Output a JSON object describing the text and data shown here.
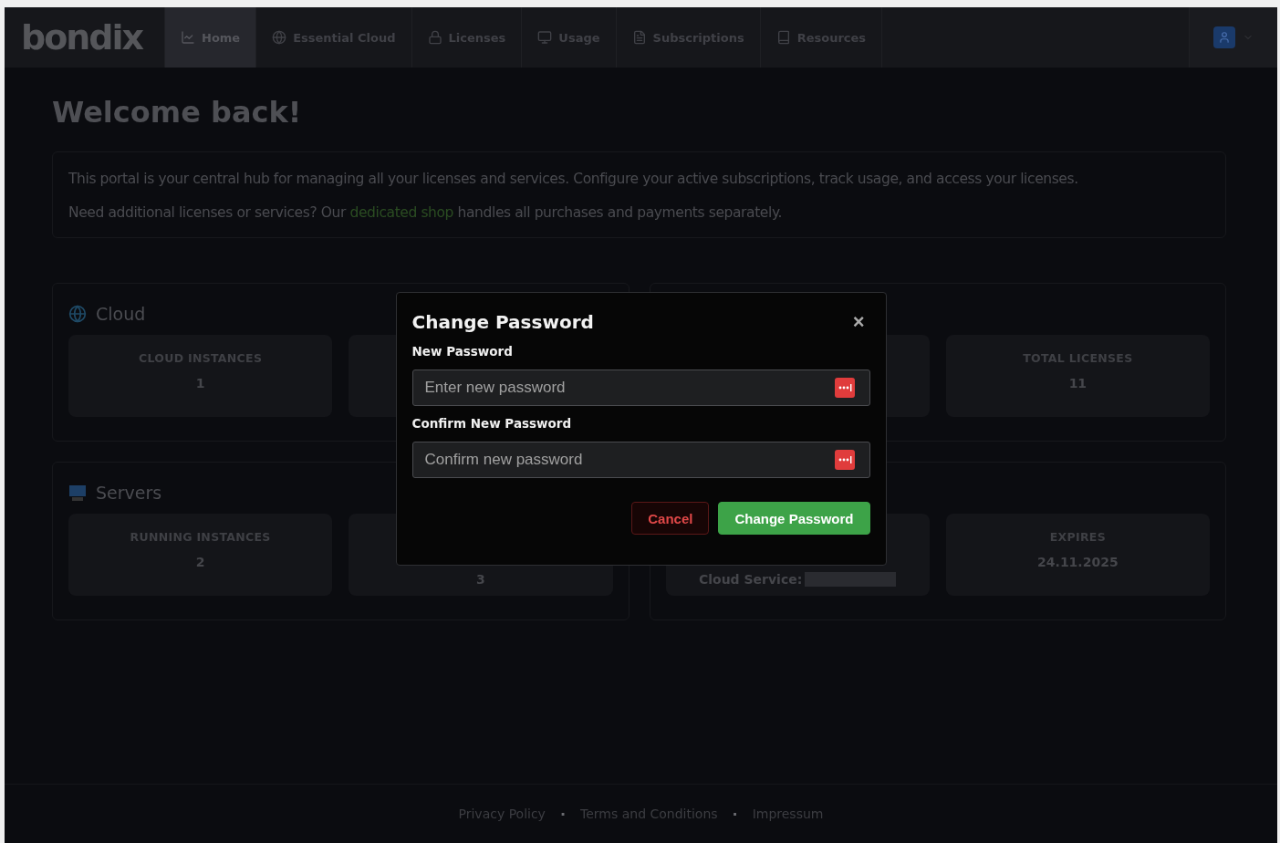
{
  "nav": {
    "logo": "bondix",
    "items": [
      {
        "label": "Home",
        "selected": true
      },
      {
        "label": "Essential Cloud",
        "selected": false
      },
      {
        "label": "Licenses",
        "selected": false
      },
      {
        "label": "Usage",
        "selected": false
      },
      {
        "label": "Subscriptions",
        "selected": false
      },
      {
        "label": "Resources",
        "selected": false
      }
    ]
  },
  "page": {
    "title": "Welcome back!",
    "intro": [
      "This portal is your central hub for managing all your licenses and services. Configure your active subscriptions, track usage, and access your licenses."
    ],
    "shop_line": {
      "before": "Need additional licenses or services? Our",
      "link": "dedicated shop",
      "after": "handles all purchases and payments separately."
    }
  },
  "sections": [
    {
      "title": "Cloud",
      "stats": [
        {
          "label": "CLOUD INSTANCES",
          "value": "1"
        }
      ]
    },
    {
      "stats": [
        {
          "label": "TOTAL LICENSES",
          "value": "11"
        }
      ]
    },
    {
      "title": "Servers",
      "stats": [
        {
          "label": "RUNNING INSTANCES",
          "value": "2"
        },
        {
          "value": "3"
        }
      ]
    },
    {
      "stats": [
        {
          "value": "Cloud Service:",
          "redacted": true
        },
        {
          "label": "EXPIRES",
          "value": "24.11.2025"
        }
      ]
    }
  ],
  "footer": {
    "links": [
      "Privacy Policy",
      "Terms and Conditions",
      "Impressum"
    ],
    "separator": "·"
  },
  "dialog": {
    "title": "Change Password",
    "close": "×",
    "fields": [
      {
        "label": "New Password",
        "placeholder": "Enter new password"
      },
      {
        "label": "Confirm New Password",
        "placeholder": "Confirm new password"
      }
    ],
    "buttons": [
      {
        "label": "Cancel",
        "kind": "cancel"
      },
      {
        "label": "Change Password",
        "kind": "primary"
      }
    ]
  }
}
